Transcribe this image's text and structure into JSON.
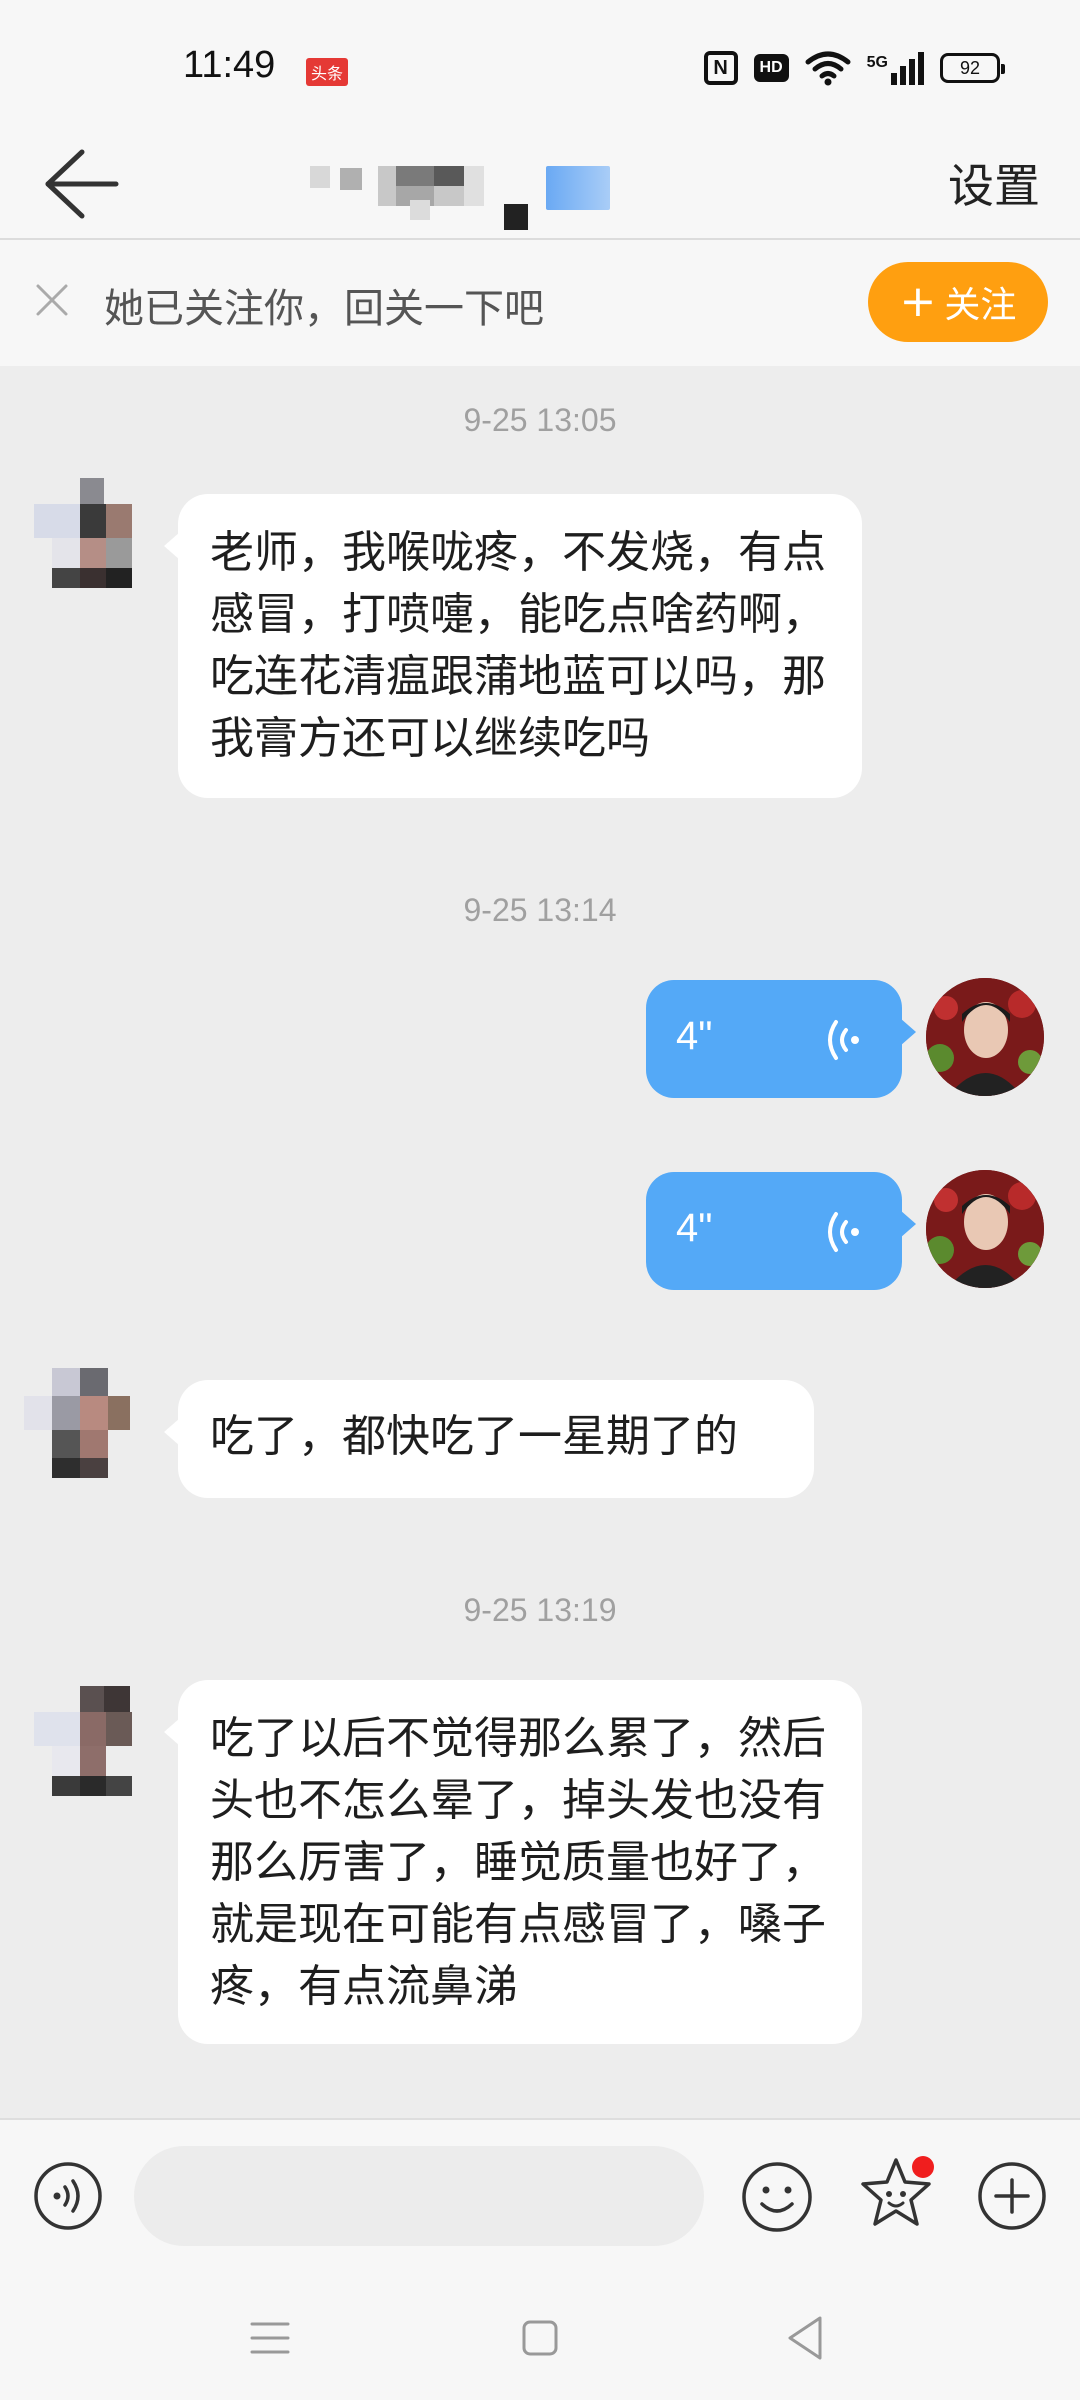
{
  "status_bar": {
    "time": "11:49",
    "app_badge": "头条",
    "nfc_label": "N",
    "hd_label": "HD",
    "signal_label": "5G",
    "battery": "92"
  },
  "header": {
    "settings_label": "设置"
  },
  "follow_banner": {
    "text": "她已关注你，回关一下吧",
    "button_label": "关注",
    "button_plus": "+"
  },
  "messages": [
    {
      "type": "timestamp",
      "text": "9-25 13:05"
    },
    {
      "type": "incoming",
      "text": "老师，我喉咙疼，不发烧，有点感冒，打喷嚏，能吃点啥药啊，吃连花清瘟跟蒲地蓝可以吗，那我膏方还可以继续吃吗"
    },
    {
      "type": "timestamp",
      "text": "9-25 13:14"
    },
    {
      "type": "outgoing-voice",
      "duration": "4\""
    },
    {
      "type": "outgoing-voice",
      "duration": "4\""
    },
    {
      "type": "incoming",
      "text": "吃了，都快吃了一星期了的"
    },
    {
      "type": "timestamp",
      "text": "9-25 13:19"
    },
    {
      "type": "incoming",
      "text": "吃了以后不觉得那么累了，然后头也不怎么晕了，掉头发也没有那么厉害了，睡觉质量也好了，就是现在可能有点感冒了，嗓子疼，有点流鼻涕"
    }
  ],
  "input_bar": {
    "placeholder": ""
  },
  "colors": {
    "accent_orange": "#ff9f10",
    "voice_bubble": "#54a9f7",
    "badge_red": "#f01e1e",
    "chat_bg": "#ededed"
  },
  "icons": [
    "back-arrow-icon",
    "close-icon",
    "voice-wave-icon",
    "voice-toggle-icon",
    "emoji-icon",
    "sticker-icon",
    "plus-circle-icon",
    "menu-icon",
    "home-icon",
    "back-triangle-icon"
  ]
}
